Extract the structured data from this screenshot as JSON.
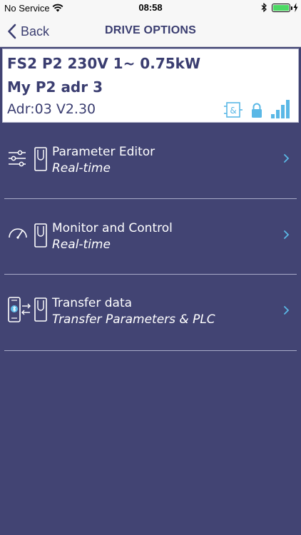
{
  "status_bar": {
    "carrier": "No Service",
    "time": "08:58",
    "battery_level": 1.0,
    "wifi_icon": "wifi-icon",
    "bluetooth_icon": "bluetooth-icon"
  },
  "nav": {
    "back_label": "Back",
    "title": "DRIVE OPTIONS"
  },
  "drive": {
    "model": "FS2 P2 230V 1~ 0.75kW",
    "name": "My P2 adr 3",
    "address_version": "Adr:03 V2.30",
    "signal_level": 4
  },
  "menu": {
    "items": [
      {
        "title": "Parameter Editor",
        "subtitle": "Real-time",
        "icon": "sliders-icon"
      },
      {
        "title": "Monitor and Control",
        "subtitle": "Real-time",
        "icon": "gauge-icon"
      },
      {
        "title": "Transfer data",
        "subtitle": "Transfer Parameters & PLC",
        "icon": "phone-transfer-icon"
      }
    ]
  },
  "colors": {
    "background": "#424473",
    "accent_cyan": "#5ab8e6",
    "text_dark": "#3a3d70",
    "bar_light": "#f7f7f7"
  }
}
